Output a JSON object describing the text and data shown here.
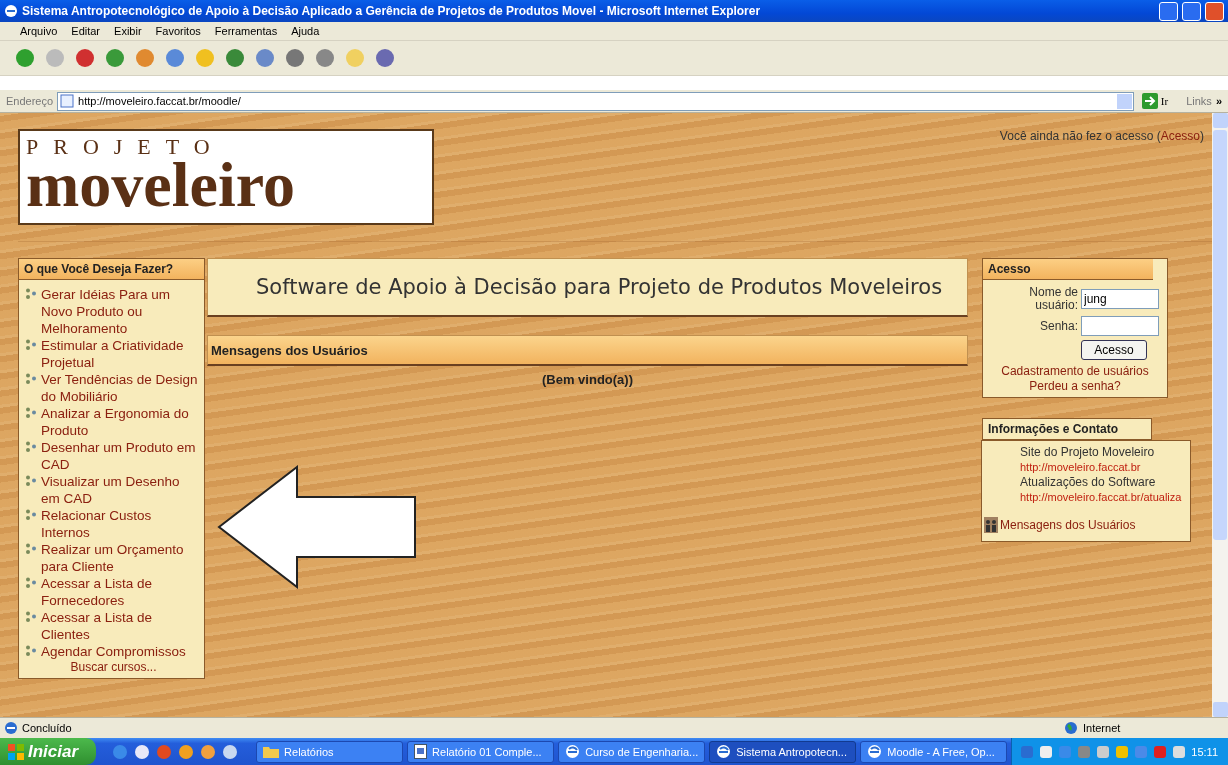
{
  "window": {
    "title": "Sistema Antropotecnológico de Apoio à Decisão Aplicado a Gerência de Projetos de Produtos Movel - Microsoft Internet Explorer"
  },
  "menu": [
    "Arquivo",
    "Editar",
    "Exibir",
    "Favoritos",
    "Ferramentas",
    "Ajuda"
  ],
  "address": {
    "label": "Endereço",
    "url": "http://moveleiro.faccat.br/moodle/",
    "go": "Ir",
    "links": "Links",
    "more": "»"
  },
  "logo": {
    "top": "PROJETO",
    "main": "moveleiro"
  },
  "login_notice": {
    "prefix": "Você ainda não fez o acesso (",
    "link": "Acesso",
    "suffix": ")"
  },
  "left_block": {
    "title": "O que Você Deseja Fazer?",
    "items": [
      "Gerar Idéias Para um Novo Produto ou Melhoramento",
      "Estimular a Criatividade Projetual",
      "Ver Tendências de Design do Mobiliário",
      "Analizar a Ergonomia do Produto",
      "Desenhar um Produto em CAD",
      "Visualizar um Desenho em CAD",
      "Relacionar Custos Internos",
      "Realizar um Orçamento para Cliente",
      "Acessar a Lista de Fornecedores",
      "Acessar a Lista de Clientes",
      "Agendar Compromissos"
    ],
    "footer": "Buscar cursos..."
  },
  "center": {
    "title": "Software de Apoio à Decisão para Projeto de Produtos Moveleiros",
    "messages_title": "Mensagens dos Usuários",
    "welcome": "(Bem vindo(a))"
  },
  "login_block": {
    "title": "Acesso",
    "username_label": "Nome de usuário:",
    "username_value": "jung",
    "password_label": "Senha:",
    "button": "Acesso",
    "links": [
      "Cadastramento de usuários",
      "Perdeu a senha?"
    ]
  },
  "info_block": {
    "title": "Informações e Contato",
    "entries": [
      {
        "kind": "label",
        "text": "Site do Projeto Moveleiro"
      },
      {
        "kind": "link",
        "text": "http://moveleiro.faccat.br"
      },
      {
        "kind": "label",
        "text": "Atualizações do Software"
      },
      {
        "kind": "link",
        "text": "http://moveleiro.faccat.br/atualiza"
      }
    ],
    "messages_link": "Mensagens dos Usuários"
  },
  "status_bar": {
    "text": "Concluído",
    "zone": "Internet"
  },
  "taskbar": {
    "start": "Iniciar",
    "tasks": [
      {
        "label": "Relatórios",
        "kind": "folder",
        "selected": false
      },
      {
        "label": "Relatório 01 Comple...",
        "kind": "document",
        "selected": false
      },
      {
        "label": "Curso de Engenharia...",
        "kind": "browser",
        "selected": false
      },
      {
        "label": "Sistema Antropotecn...",
        "kind": "browser",
        "selected": true
      },
      {
        "label": "Moodle - A Free, Op...",
        "kind": "browser",
        "selected": false
      }
    ],
    "clock": "15:11"
  }
}
